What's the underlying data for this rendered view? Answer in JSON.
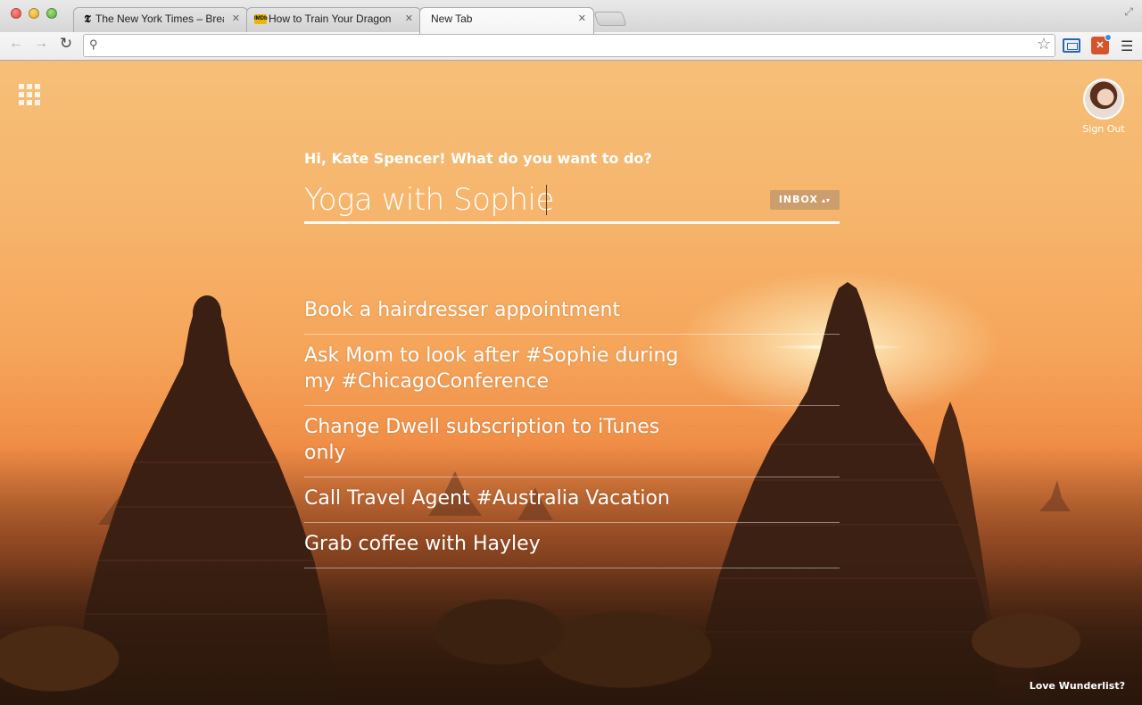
{
  "browser": {
    "tabs": [
      {
        "title": "The New York Times – Breaking",
        "favicon": "nyt-logo-icon",
        "active": false
      },
      {
        "title": "How to Train Your Dragon",
        "favicon": "imdb-logo-icon",
        "active": false
      },
      {
        "title": "New Tab",
        "favicon": "",
        "active": true
      }
    ],
    "tab_close_glyph": "✕",
    "address_bar": {
      "value": "",
      "placeholder": ""
    },
    "favicons": {
      "nyt": "𝕿",
      "imdb": "IMDb"
    },
    "wunderlist_ext_glyph": "✕"
  },
  "app": {
    "greeting": "Hi, Kate Spencer! What do you want to do?",
    "input_value": "Yoga with Sophie",
    "list_selector": "INBOX",
    "list_selector_arrows": "▴▾",
    "tasks": [
      "Book a hairdresser appointment",
      "Ask Mom to look after #Sophie during my #ChicagoConference",
      "Change Dwell subscription to iTunes only",
      "Call Travel Agent #Australia Vacation",
      "Grab coffee with Hayley"
    ],
    "sign_out": "Sign Out",
    "footer_link": "Love Wunderlist?"
  },
  "colors": {
    "sky_top": "#f6bf78",
    "sky_mid": "#ef8a44",
    "ground": "#4d2b16",
    "text": "#ffffff",
    "list_selector_bg": "#be966e"
  }
}
